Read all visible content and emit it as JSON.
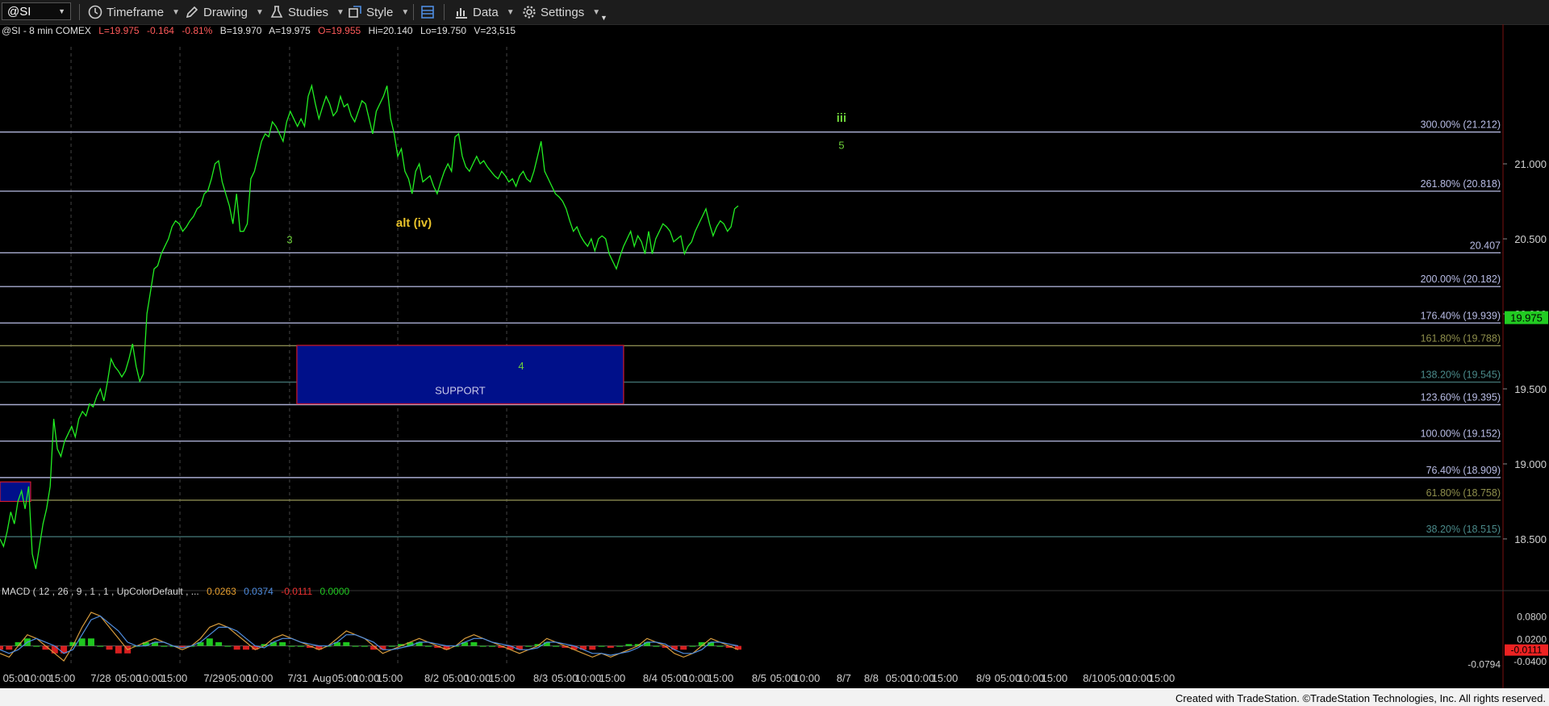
{
  "toolbar": {
    "symbol": "@SI",
    "timeframe": "Timeframe",
    "drawing": "Drawing",
    "studies": "Studies",
    "style": "Style",
    "data": "Data",
    "settings": "Settings"
  },
  "header": {
    "instrument": "@SI - 8 min  COMEX",
    "last": "L=19.975",
    "change": "-0.164",
    "change_pct": "-0.81%",
    "bid": "B=19.970",
    "ask": "A=19.975",
    "open": "O=19.955",
    "high": "Hi=20.140",
    "low": "Lo=19.750",
    "volume": "V=23,515"
  },
  "macd_header": {
    "label": "MACD ( 12 , 26 , 9 , 1 , 1 , UpColorDefault , ...",
    "v1": "0.0263",
    "v2": "0.0374",
    "v3": "-0.0111",
    "v4": "0.0000"
  },
  "footer": "Created with TradeStation. ©TradeStation Technologies, Inc. All rights reserved.",
  "colors": {
    "price": "#22ee22",
    "macd_line": "#d59a3c",
    "signal_line": "#4f8de0",
    "hist_up": "#22dd22",
    "hist_down": "#ee2222",
    "support_fill": "#00108a",
    "support_border": "#d41a2a",
    "fib_line": "#a8acd0",
    "fib_label": "#b9bde6",
    "fib_label_alt": "#8f8f4c",
    "fib_label_teal": "#4a8a8a",
    "wave_green": "#6dd13a",
    "alt_yellow": "#e8c22a"
  },
  "chart_data": {
    "type": "line",
    "title": "",
    "ylim": [
      18.22,
      21.78
    ],
    "y_ticks": [
      "21.000",
      "20.500",
      "20.000",
      "19.500",
      "19.000",
      "18.500"
    ],
    "y_tick_values": [
      21.0,
      20.5,
      20.0,
      19.5,
      19.0,
      18.5
    ],
    "x_tick_labels": [
      "05:00",
      "10:00",
      "15:00",
      "7/28",
      "05:00",
      "10:00",
      "15:00",
      "7/29",
      "05:00",
      "10:00",
      "7/31",
      "Aug",
      "05:00",
      "10:00",
      "15:00",
      "8/2",
      "05:00",
      "10:00",
      "15:00",
      "8/3",
      "05:00",
      "10:00",
      "15:00",
      "8/4",
      "05:00",
      "10:00",
      "15:00",
      "8/5",
      "05:00",
      "10:00",
      "8/7",
      "8/8",
      "05:00",
      "10:00",
      "15:00",
      "8/9",
      "05:00",
      "10:00",
      "15:00",
      "8/10",
      "05:00",
      "10:00",
      "15:00"
    ],
    "x_tick_fracs": [
      0.0133,
      0.0313,
      0.0513,
      0.0833,
      0.106,
      0.124,
      0.144,
      0.1767,
      0.1967,
      0.2147,
      0.246,
      0.266,
      0.2853,
      0.3027,
      0.322,
      0.3567,
      0.3767,
      0.3947,
      0.4147,
      0.4467,
      0.4667,
      0.486,
      0.506,
      0.5373,
      0.5573,
      0.5753,
      0.5953,
      0.6273,
      0.6473,
      0.6667,
      0.6973,
      0.72,
      0.7427,
      0.7613,
      0.7807,
      0.8127,
      0.8327,
      0.852,
      0.8713,
      0.9033,
      0.9233,
      0.9413,
      0.96
    ],
    "day_separators": [
      0.0587,
      0.1487,
      0.2393,
      0.3287,
      0.4187
    ],
    "x_count": 180,
    "series": [
      {
        "values": [
          18.5,
          18.45,
          18.55,
          18.68,
          18.6,
          18.75,
          18.82,
          18.7,
          18.85,
          18.4,
          18.3,
          18.45,
          18.6,
          18.7,
          18.85,
          19.3,
          19.1,
          19.05,
          19.15,
          19.2,
          19.25,
          19.18,
          19.3,
          19.35,
          19.32,
          19.4,
          19.38,
          19.45,
          19.5,
          19.42,
          19.55,
          19.7,
          19.65,
          19.62,
          19.58,
          19.62,
          19.7,
          19.8,
          19.65,
          19.55,
          19.6,
          20.0,
          20.15,
          20.3,
          20.32,
          20.4,
          20.45,
          20.5,
          20.58,
          20.62,
          20.6,
          20.55,
          20.58,
          20.62,
          20.65,
          20.7,
          20.72,
          20.8,
          20.82,
          20.9,
          21.0,
          21.02,
          20.88,
          20.8,
          20.72,
          20.6,
          20.8,
          20.55,
          20.55,
          20.6,
          20.9,
          20.95,
          21.05,
          21.15,
          21.2,
          21.18,
          21.28,
          21.25,
          21.2,
          21.15,
          21.28,
          21.35,
          21.3,
          21.25,
          21.3,
          21.25,
          21.45,
          21.52,
          21.4,
          21.3,
          21.38,
          21.45,
          21.4,
          21.32,
          21.35,
          21.45,
          21.38,
          21.4,
          21.32,
          21.28,
          21.35,
          21.42,
          21.4,
          21.3,
          21.2,
          21.35,
          21.4,
          21.45,
          21.52,
          21.3,
          21.2,
          21.05,
          21.1,
          20.95,
          20.9,
          20.8,
          20.95,
          21.0,
          20.88,
          20.9,
          20.92,
          20.85,
          20.8,
          20.88,
          20.95,
          21.0,
          20.95,
          21.18,
          21.2,
          21.05,
          20.98,
          20.95,
          21.0,
          21.05,
          21.0,
          21.02,
          20.98,
          20.95,
          20.92,
          20.9,
          20.95,
          20.92,
          20.88,
          20.9,
          20.85,
          20.92,
          20.95,
          20.9,
          20.88,
          20.95,
          21.05,
          21.15,
          20.95,
          20.9,
          20.85,
          20.8,
          20.78,
          20.75,
          20.7,
          20.62,
          20.55,
          20.58,
          20.52,
          20.48,
          20.45,
          20.5,
          20.42,
          20.5,
          20.52,
          20.5,
          20.4,
          20.35,
          20.3,
          20.38,
          20.45,
          20.5,
          20.55,
          20.45,
          20.52,
          20.48,
          20.4,
          20.55,
          20.4,
          20.5,
          20.55,
          20.6,
          20.58,
          20.55,
          20.48,
          20.5,
          20.52,
          20.4,
          20.45,
          20.48,
          20.55,
          20.6,
          20.65,
          20.7,
          20.6,
          20.52,
          20.58,
          20.62,
          20.6,
          20.55,
          20.58,
          20.7,
          20.72
        ]
      }
    ],
    "fib_levels": [
      {
        "label": "300.00% (21.212)",
        "value": 21.212,
        "style": "fib"
      },
      {
        "label": "261.80% (20.818)",
        "value": 20.818,
        "style": "fib"
      },
      {
        "label": "20.407",
        "value": 20.407,
        "style": "fib"
      },
      {
        "label": "200.00% (20.182)",
        "value": 20.182,
        "style": "fib"
      },
      {
        "label": "176.40% (19.939)",
        "value": 19.939,
        "style": "fib"
      },
      {
        "label": "161.80% (19.788)",
        "value": 19.788,
        "style": "alt"
      },
      {
        "label": "138.20% (19.545)",
        "value": 19.545,
        "style": "teal"
      },
      {
        "label": "123.60% (19.395)",
        "value": 19.395,
        "style": "fib"
      },
      {
        "label": "100.00% (19.152)",
        "value": 19.152,
        "style": "fib"
      },
      {
        "label": "76.40% (18.909)",
        "value": 18.909,
        "style": "fib"
      },
      {
        "label": "61.80% (18.758)",
        "value": 18.758,
        "style": "alt"
      },
      {
        "label": "38.20% (18.515)",
        "value": 18.515,
        "style": "teal"
      }
    ],
    "support_zone": {
      "label": "SUPPORT",
      "x_from": 0.2453,
      "x_to": 0.5153,
      "y_top": 19.79,
      "y_bottom": 19.4
    },
    "left_box": {
      "x_from": 0.0,
      "x_to": 0.0253,
      "y_top": 18.88,
      "y_bottom": 18.75
    },
    "annotations": [
      {
        "text": "iii",
        "x": 0.6953,
        "y": 21.28,
        "color": "wave_green",
        "bold": true
      },
      {
        "text": "5",
        "x": 0.6953,
        "y": 21.1,
        "color": "wave_green",
        "bold": false
      },
      {
        "text": "alt (iv)",
        "x": 0.342,
        "y": 20.58,
        "color": "alt_yellow",
        "bold": true
      },
      {
        "text": "3",
        "x": 0.2393,
        "y": 20.47,
        "color": "wave_green",
        "bold": false
      },
      {
        "text": "4",
        "x": 0.4307,
        "y": 19.63,
        "color": "wave_green",
        "bold": false
      }
    ],
    "last_price_label": "19.975",
    "last_price_value": 19.975,
    "macd": {
      "ylim": [
        -0.055,
        0.12
      ],
      "y_ticks": [
        "0.0800",
        "0.0200",
        "-0.0400"
      ],
      "y_tick_values": [
        0.08,
        0.02,
        -0.04
      ],
      "last_label": "-0.0111",
      "extra_label": "-0.0794",
      "macd_values": [
        -0.02,
        -0.03,
        0.0,
        0.03,
        0.02,
        0.0,
        -0.02,
        -0.04,
        0.0,
        0.05,
        0.09,
        0.08,
        0.05,
        0.02,
        -0.01,
        0.0,
        0.01,
        0.02,
        0.01,
        0.0,
        -0.01,
        0.0,
        0.02,
        0.05,
        0.06,
        0.05,
        0.03,
        0.01,
        -0.01,
        0.0,
        0.02,
        0.03,
        0.02,
        0.01,
        0.0,
        -0.01,
        0.0,
        0.02,
        0.04,
        0.03,
        0.02,
        0.0,
        -0.02,
        -0.01,
        0.0,
        0.01,
        0.02,
        0.01,
        0.0,
        -0.01,
        0.0,
        0.02,
        0.03,
        0.02,
        0.01,
        0.0,
        -0.01,
        -0.02,
        -0.01,
        0.0,
        0.02,
        0.01,
        0.0,
        -0.01,
        -0.02,
        -0.03,
        -0.02,
        -0.03,
        -0.02,
        -0.01,
        0.0,
        0.02,
        0.01,
        0.0,
        -0.02,
        -0.03,
        -0.02,
        0.0,
        0.02,
        0.01,
        0.0,
        -0.01
      ],
      "signal_values": [
        -0.01,
        -0.02,
        -0.01,
        0.01,
        0.02,
        0.01,
        0.0,
        -0.02,
        -0.01,
        0.03,
        0.07,
        0.08,
        0.06,
        0.04,
        0.01,
        0.0,
        0.0,
        0.01,
        0.01,
        0.0,
        -0.005,
        0.0,
        0.01,
        0.03,
        0.05,
        0.05,
        0.04,
        0.02,
        0.0,
        -0.005,
        0.01,
        0.02,
        0.02,
        0.01,
        0.005,
        0.0,
        0.0,
        0.01,
        0.03,
        0.03,
        0.02,
        0.01,
        -0.01,
        -0.01,
        -0.005,
        0.0,
        0.01,
        0.01,
        0.005,
        0.0,
        0.0,
        0.01,
        0.02,
        0.02,
        0.01,
        0.005,
        0.0,
        -0.01,
        -0.01,
        -0.005,
        0.01,
        0.01,
        0.005,
        0.0,
        -0.01,
        -0.02,
        -0.02,
        -0.025,
        -0.02,
        -0.015,
        -0.005,
        0.01,
        0.01,
        0.005,
        -0.01,
        -0.02,
        -0.02,
        -0.01,
        0.01,
        0.01,
        0.005,
        0.0
      ]
    }
  }
}
